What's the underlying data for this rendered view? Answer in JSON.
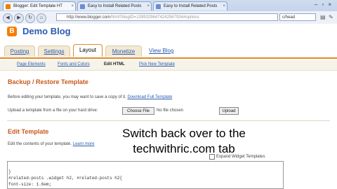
{
  "browser": {
    "tabs": [
      {
        "label": "Blogger: Edit Template HT"
      },
      {
        "label": "Easy to Install Related Posts"
      },
      {
        "label": "Easy to Install Related Posts"
      }
    ],
    "url": "http://www.blogger.com/html?blogID=1399329647424567934#options",
    "url_prefix": "http://www.blogger.com",
    "url_rest": "/html?blogID=13993296474242567934#options",
    "find_text": "c/head"
  },
  "blog": {
    "title": "Demo Blog",
    "tabs": [
      "Posting",
      "Settings",
      "Layout",
      "Monetize"
    ],
    "view_blog": "View Blog",
    "subtabs": [
      "Page Elements",
      "Fonts and Colors",
      "Edit HTML",
      "Pick New Template"
    ]
  },
  "backup": {
    "title": "Backup / Restore Template",
    "before_text": "Before editing your template, you may want to save a copy of it.",
    "download_link": "Download Full Template",
    "upload_text": "Upload a template from a file on your hard drive:",
    "choose_file": "Choose File",
    "no_file": "No file chosen",
    "upload_button": "Upload"
  },
  "edit": {
    "title": "Edit Template",
    "intro": "Edit the contents of your template.",
    "learn_more": "Learn more",
    "expand_widgets": "Expand Widget Templates",
    "code_lines": [
      "}",
      "#related-posts .widget h2, #related-posts h2{",
      "font-size: 1.6em;"
    ]
  },
  "overlay": {
    "line1": "Switch back over to the",
    "line2": "techwithric.com tab"
  }
}
